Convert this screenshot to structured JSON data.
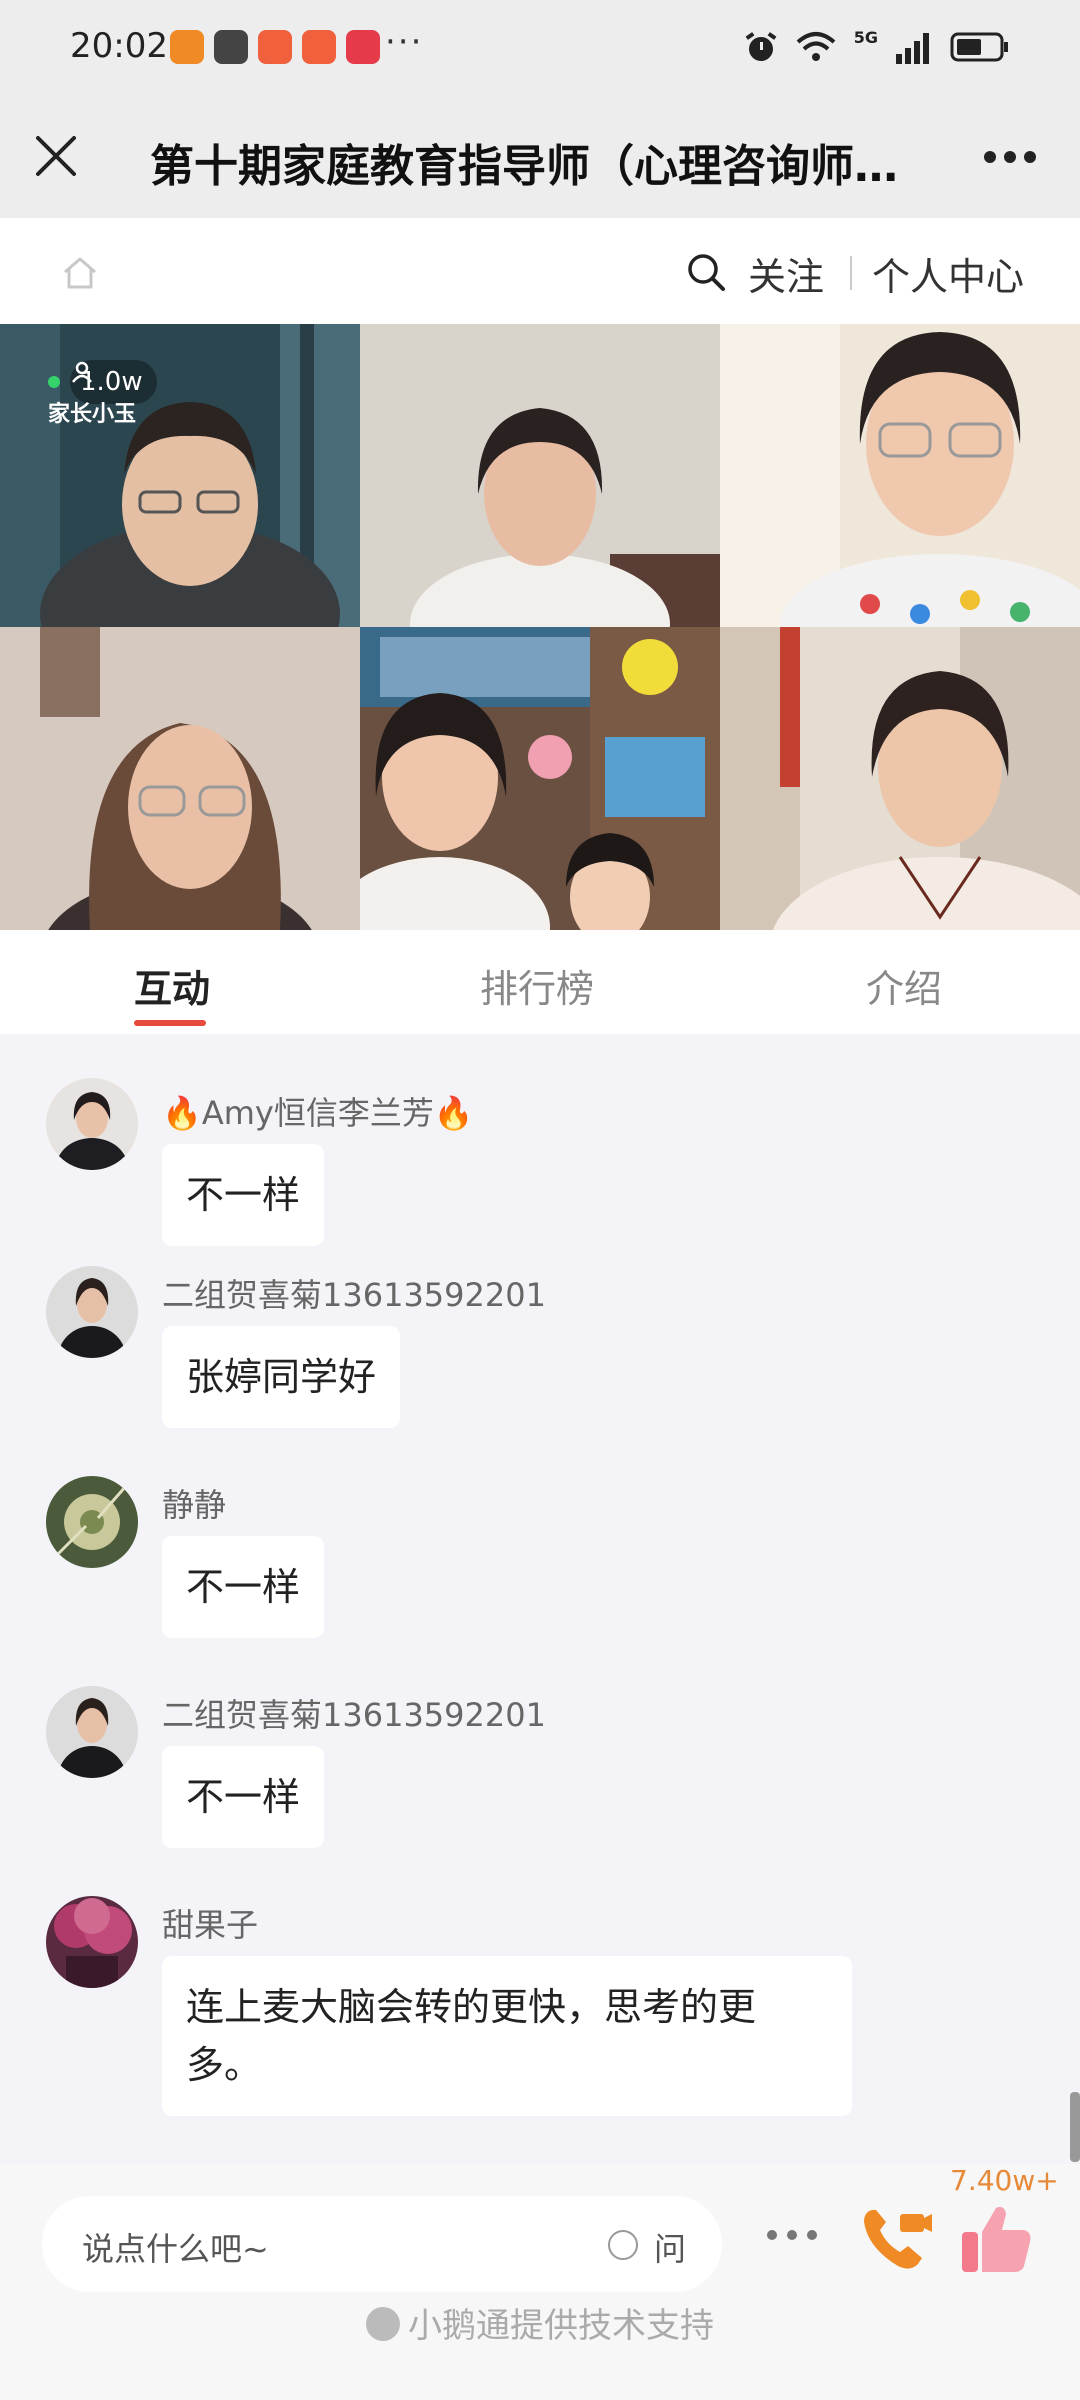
{
  "status_bar": {
    "time": "20:02",
    "more": "···",
    "network": "5G"
  },
  "title_bar": {
    "title": "第十期家庭教育指导师（心理咨询师…"
  },
  "nav": {
    "follow": "关注",
    "personal_center": "个人中心"
  },
  "video": {
    "viewer_count": "1.0w",
    "host_tag": "家长小玉"
  },
  "tabs": [
    {
      "label": "互动",
      "active": true
    },
    {
      "label": "排行榜",
      "active": false
    },
    {
      "label": "介绍",
      "active": false
    }
  ],
  "chat": {
    "messages": [
      {
        "user": "Amy恒信李兰芳",
        "text": "不一样"
      },
      {
        "user": "二组贺喜菊13613592201",
        "text": "张婷同学好"
      },
      {
        "user": "静静",
        "text": "不一样"
      },
      {
        "user": "二组贺喜菊13613592201",
        "text": "不一样"
      },
      {
        "user": "甜果子",
        "text": "连上麦大脑会转的更快，思考的更多。"
      }
    ]
  },
  "bottom": {
    "input_placeholder": "说点什么吧~",
    "ask_label": "问",
    "like_count": "7.40w+",
    "powered_by": "小鹅通提供技术支持"
  },
  "colors": {
    "accent": "#e54a3c",
    "like_count": "#e68a3a",
    "phone_icon": "#f08a24",
    "like_icon": "#f27a8a"
  }
}
